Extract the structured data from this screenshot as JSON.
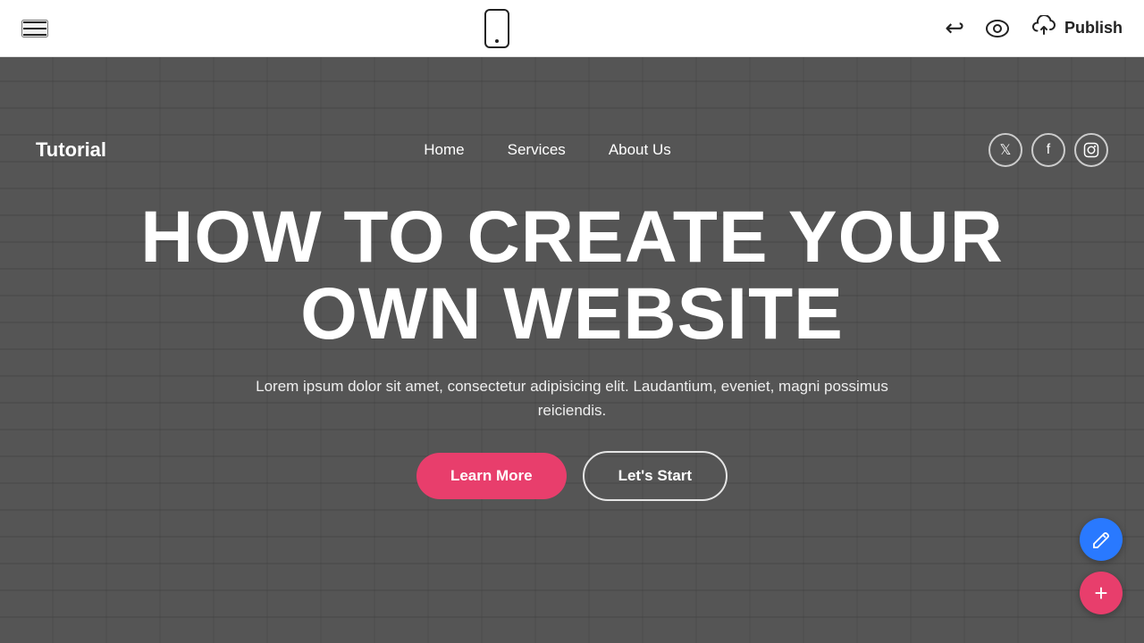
{
  "toolbar": {
    "hamburger_label": "menu",
    "undo_label": "undo",
    "preview_label": "preview",
    "publish_label": "Publish",
    "mobile_preview_label": "mobile view"
  },
  "site": {
    "logo": "Tutorial",
    "nav": {
      "links": [
        {
          "label": "Home",
          "id": "nav-home"
        },
        {
          "label": "Services",
          "id": "nav-services"
        },
        {
          "label": "About Us",
          "id": "nav-about"
        }
      ]
    },
    "social": [
      {
        "label": "Twitter",
        "icon": "𝕋"
      },
      {
        "label": "Facebook",
        "icon": "f"
      },
      {
        "label": "Instagram",
        "icon": "📷"
      }
    ],
    "hero": {
      "title": "HOW TO CREATE YOUR OWN WEBSITE",
      "subtitle": "Lorem ipsum dolor sit amet, consectetur adipisicing elit. Laudantium, eveniet, magni possimus reiciendis.",
      "btn_learn_more": "Learn More",
      "btn_lets_start": "Let's Start"
    }
  },
  "fab": {
    "edit_label": "edit",
    "add_label": "add"
  }
}
